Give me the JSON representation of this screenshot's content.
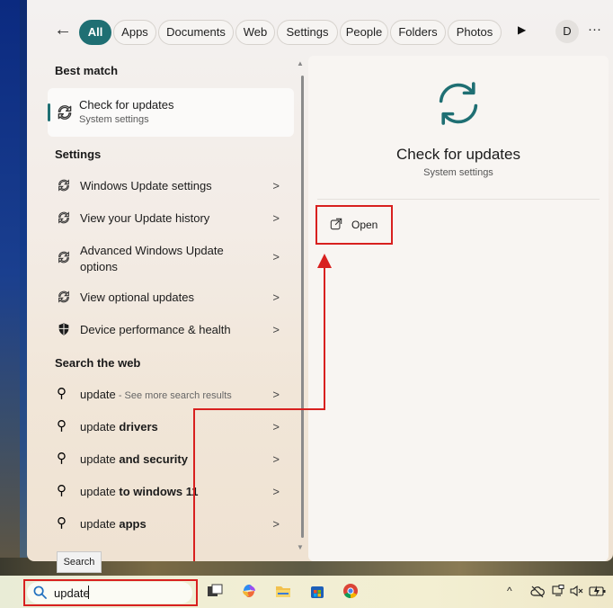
{
  "filters": {
    "tabs": [
      "All",
      "Apps",
      "Documents",
      "Web",
      "Settings",
      "People",
      "Folders",
      "Photos"
    ],
    "avatar_letter": "D",
    "more": "···"
  },
  "best_match": {
    "heading": "Best match",
    "title": "Check for updates",
    "subtitle": "System settings"
  },
  "settings": {
    "heading": "Settings",
    "items": [
      {
        "label": "Windows Update settings",
        "icon": "sync-icon"
      },
      {
        "label": "View your Update history",
        "icon": "sync-icon"
      },
      {
        "label": "Advanced Windows Update options",
        "icon": "sync-icon"
      },
      {
        "label": "View optional updates",
        "icon": "sync-icon"
      },
      {
        "label": "Device performance & health",
        "icon": "shield-icon"
      }
    ]
  },
  "web": {
    "heading": "Search the web",
    "items": [
      {
        "pre": "update",
        "bold": "",
        "suffix": " - See more search results"
      },
      {
        "pre": "update ",
        "bold": "drivers",
        "suffix": ""
      },
      {
        "pre": "update ",
        "bold": "and security",
        "suffix": ""
      },
      {
        "pre": "update ",
        "bold": "to windows 11",
        "suffix": ""
      },
      {
        "pre": "update ",
        "bold": "apps",
        "suffix": ""
      }
    ]
  },
  "detail": {
    "title": "Check for updates",
    "subtitle": "System settings",
    "open_label": "Open"
  },
  "taskbar": {
    "search_value": "update",
    "tooltip": "Search"
  },
  "colors": {
    "accent": "#1f6f73",
    "highlight_red": "#d8201f"
  }
}
